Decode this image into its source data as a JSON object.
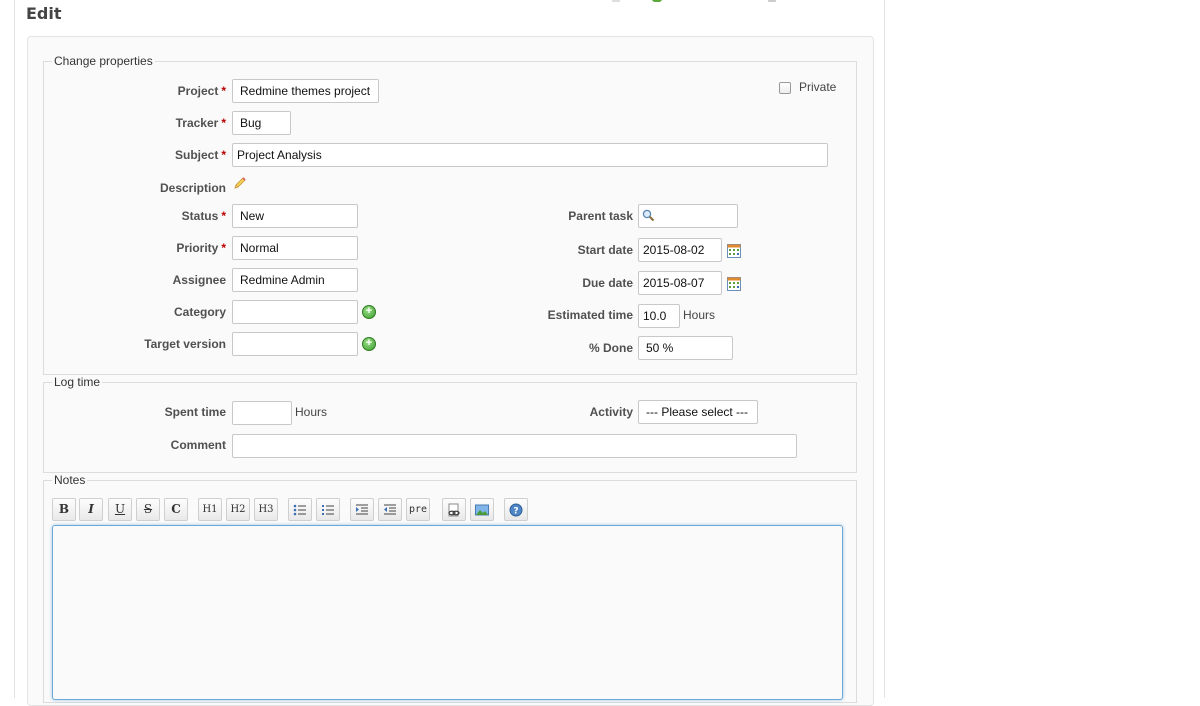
{
  "page": {
    "title": "Edit"
  },
  "change_properties": {
    "legend": "Change properties",
    "project": {
      "label": "Project",
      "value": "Redmine themes project"
    },
    "private": {
      "label": "Private"
    },
    "tracker": {
      "label": "Tracker",
      "value": "Bug"
    },
    "subject": {
      "label": "Subject",
      "value": "Project Analysis"
    },
    "description": {
      "label": "Description"
    },
    "status": {
      "label": "Status",
      "value": "New"
    },
    "priority": {
      "label": "Priority",
      "value": "Normal"
    },
    "assignee": {
      "label": "Assignee",
      "value": "Redmine Admin"
    },
    "category": {
      "label": "Category",
      "value": ""
    },
    "target_version": {
      "label": "Target version",
      "value": ""
    },
    "parent_task": {
      "label": "Parent task",
      "value": ""
    },
    "start_date": {
      "label": "Start date",
      "value": "2015-08-02"
    },
    "due_date": {
      "label": "Due date",
      "value": "2015-08-07"
    },
    "estimated_time": {
      "label": "Estimated time",
      "value": "10.0",
      "unit": "Hours"
    },
    "done_ratio": {
      "label": "% Done",
      "value": "50 %"
    },
    "required_marker": "*"
  },
  "log_time": {
    "legend": "Log time",
    "spent_time": {
      "label": "Spent time",
      "value": "",
      "unit": "Hours"
    },
    "activity": {
      "label": "Activity",
      "value": "--- Please select ---"
    },
    "comment": {
      "label": "Comment",
      "value": ""
    }
  },
  "notes": {
    "legend": "Notes",
    "toolbar": {
      "bold": "B",
      "italic": "I",
      "underline": "U",
      "strike": "S",
      "code": "C",
      "h1": "H1",
      "h2": "H2",
      "h3": "H3",
      "pre": "pre"
    },
    "value": ""
  },
  "colors": {
    "required": "#bb0000",
    "label": "#505050",
    "focus_border": "#6aaad8"
  }
}
